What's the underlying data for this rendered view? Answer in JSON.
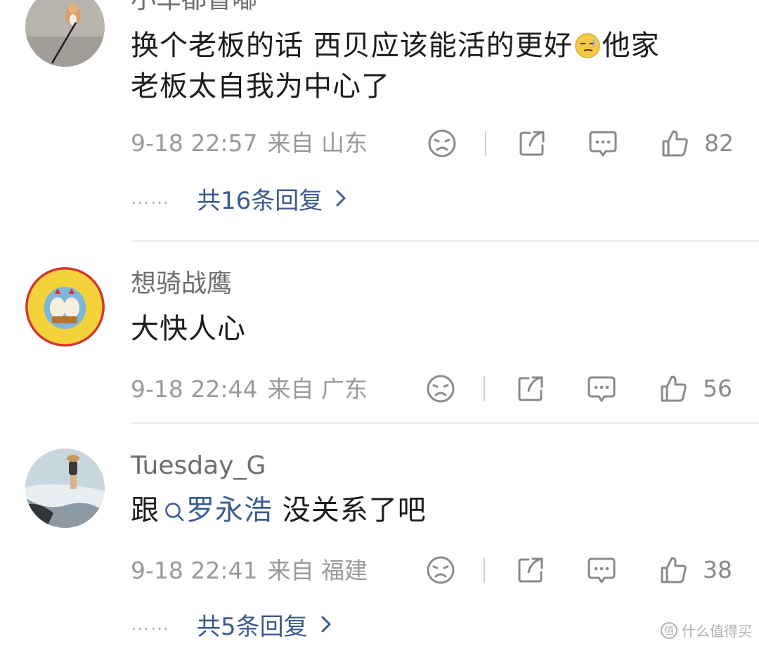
{
  "comments": [
    {
      "username": "小车都督嘟",
      "content_line1": "换个老板的话 西贝应该能活的更好",
      "content_line1_after": "他家",
      "content_line2": "老板太自我为中心了",
      "time": "9-18 22:57",
      "location": "来自 山东",
      "likes": "82",
      "replies": "共16条回复"
    },
    {
      "username": "想骑战鹰",
      "content": "大快人心",
      "time": "9-18 22:44",
      "location": "来自 广东",
      "likes": "56"
    },
    {
      "username": "Tuesday_G",
      "content_prefix": "跟",
      "mention": "罗永浩",
      "content_suffix": " 没关系了吧",
      "time": "9-18 22:41",
      "location": "来自 福建",
      "likes": "38",
      "replies": "共5条回复"
    }
  ],
  "icons": {
    "dislike": "sad-face-icon",
    "share": "share-icon",
    "comment": "comment-bubble-icon",
    "like": "thumbs-up-icon",
    "chevron": "chevron-right-icon",
    "search": "search-icon"
  },
  "colors": {
    "link": "#3b5b8e",
    "meta": "#9a9a9a",
    "username": "#6e6e6e"
  },
  "watermark": "什么值得买"
}
